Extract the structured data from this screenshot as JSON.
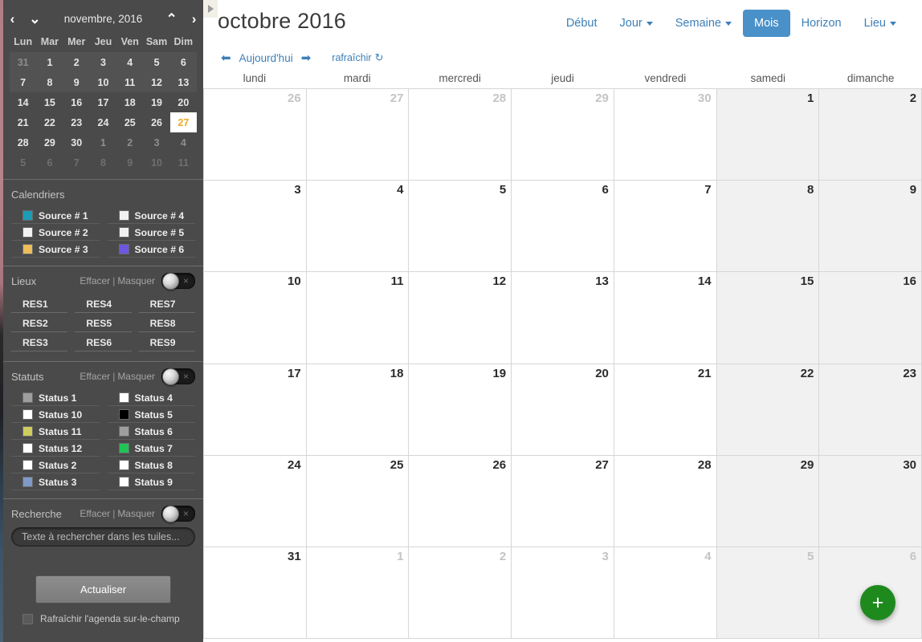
{
  "sidebar": {
    "mini_calendar": {
      "title": "novembre, 2016",
      "nav": {
        "prev": "‹",
        "down": "⌄",
        "up": "⌃",
        "next": "›"
      },
      "weekday_headers": [
        "Lun",
        "Mar",
        "Mer",
        "Jeu",
        "Ven",
        "Sam",
        "Dim"
      ],
      "weeks": [
        [
          {
            "d": "31",
            "t": "muted"
          },
          {
            "d": "1",
            "t": "cur"
          },
          {
            "d": "2",
            "t": "cur"
          },
          {
            "d": "3",
            "t": "cur"
          },
          {
            "d": "4",
            "t": "cur"
          },
          {
            "d": "5",
            "t": "cur"
          },
          {
            "d": "6",
            "t": "cur"
          }
        ],
        [
          {
            "d": "7",
            "t": "cur"
          },
          {
            "d": "8",
            "t": "cur"
          },
          {
            "d": "9",
            "t": "cur"
          },
          {
            "d": "10",
            "t": "cur"
          },
          {
            "d": "11",
            "t": "cur"
          },
          {
            "d": "12",
            "t": "cur"
          },
          {
            "d": "13",
            "t": "cur"
          }
        ],
        [
          {
            "d": "14",
            "t": "cur"
          },
          {
            "d": "15",
            "t": "cur"
          },
          {
            "d": "16",
            "t": "cur"
          },
          {
            "d": "17",
            "t": "cur"
          },
          {
            "d": "18",
            "t": "cur"
          },
          {
            "d": "19",
            "t": "cur"
          },
          {
            "d": "20",
            "t": "cur"
          }
        ],
        [
          {
            "d": "21",
            "t": "cur"
          },
          {
            "d": "22",
            "t": "cur"
          },
          {
            "d": "23",
            "t": "cur"
          },
          {
            "d": "24",
            "t": "cur"
          },
          {
            "d": "25",
            "t": "cur"
          },
          {
            "d": "26",
            "t": "cur"
          },
          {
            "d": "27",
            "t": "today"
          }
        ],
        [
          {
            "d": "28",
            "t": "cur"
          },
          {
            "d": "29",
            "t": "cur"
          },
          {
            "d": "30",
            "t": "cur"
          },
          {
            "d": "1",
            "t": "muted"
          },
          {
            "d": "2",
            "t": "muted"
          },
          {
            "d": "3",
            "t": "muted"
          },
          {
            "d": "4",
            "t": "muted"
          }
        ],
        [
          {
            "d": "5",
            "t": "dim"
          },
          {
            "d": "6",
            "t": "dim"
          },
          {
            "d": "7",
            "t": "dim"
          },
          {
            "d": "8",
            "t": "dim"
          },
          {
            "d": "9",
            "t": "dim"
          },
          {
            "d": "10",
            "t": "dim"
          },
          {
            "d": "11",
            "t": "dim"
          }
        ]
      ],
      "shaded_weeks": [
        0,
        1
      ]
    },
    "calendriers": {
      "title": "Calendriers",
      "col_left": [
        {
          "label": "Source # 1",
          "color": "#1b9cb7"
        },
        {
          "label": "Source # 2",
          "color": "#f2f2f2"
        },
        {
          "label": "Source # 3",
          "color": "#edbd5a"
        }
      ],
      "col_right": [
        {
          "label": "Source # 4",
          "color": "#f2f2f2"
        },
        {
          "label": "Source # 5",
          "color": "#f2f2f2"
        },
        {
          "label": "Source # 6",
          "color": "#6f56e0"
        }
      ]
    },
    "lieux": {
      "title": "Lieux",
      "clear_label": "Effacer",
      "separator": "|",
      "hide_label": "Masquer",
      "toggle_x": "×",
      "col1": [
        "RES1",
        "RES2",
        "RES3"
      ],
      "col2": [
        "RES4",
        "RES5",
        "RES6"
      ],
      "col3": [
        "RES7",
        "RES8",
        "RES9"
      ]
    },
    "statuts": {
      "title": "Statuts",
      "clear_label": "Effacer",
      "separator": "|",
      "hide_label": "Masquer",
      "toggle_x": "×",
      "col_left": [
        {
          "label": "Status 1",
          "color": "#9e9e9e"
        },
        {
          "label": "Status 10",
          "color": "#ffffff"
        },
        {
          "label": "Status 11",
          "color": "#cfcc5d"
        },
        {
          "label": "Status 12",
          "color": "#ffffff"
        },
        {
          "label": "Status 2",
          "color": "#ffffff"
        },
        {
          "label": "Status 3",
          "color": "#7e9ac8"
        }
      ],
      "col_right": [
        {
          "label": "Status 4",
          "color": "#ffffff"
        },
        {
          "label": "Status 5",
          "color": "#000000"
        },
        {
          "label": "Status 6",
          "color": "#9e9e9e"
        },
        {
          "label": "Status 7",
          "color": "#22c257"
        },
        {
          "label": "Status 8",
          "color": "#ffffff"
        },
        {
          "label": "Status 9",
          "color": "#ffffff"
        }
      ]
    },
    "recherche": {
      "title": "Recherche",
      "clear_label": "Effacer",
      "separator": "|",
      "hide_label": "Masquer",
      "toggle_x": "×",
      "input_value": "",
      "input_placeholder": "Texte à rechercher dans les tuiles..."
    },
    "footer": {
      "refresh_button": "Actualiser",
      "auto_refresh_label": "Rafraîchir l'agenda sur-le-champ"
    }
  },
  "main": {
    "collapse_handle_icon": "chevron-right-icon",
    "title": "octobre 2016",
    "view_buttons": [
      {
        "label": "Début",
        "active": false,
        "caret": false
      },
      {
        "label": "Jour",
        "active": false,
        "caret": true
      },
      {
        "label": "Semaine",
        "active": false,
        "caret": true
      },
      {
        "label": "Mois",
        "active": true,
        "caret": false
      },
      {
        "label": "Horizon",
        "active": false,
        "caret": false
      },
      {
        "label": "Lieu",
        "active": false,
        "caret": true
      }
    ],
    "subbar": {
      "prev_icon": "⬅",
      "today_label": "Aujourd'hui",
      "next_icon": "➡",
      "refresh_label": "rafraîchir",
      "refresh_icon": "↻"
    },
    "weekday_headers": [
      "lundi",
      "mardi",
      "mercredi",
      "jeudi",
      "vendredi",
      "samedi",
      "dimanche"
    ],
    "weeks": [
      [
        {
          "d": "26",
          "o": true
        },
        {
          "d": "27",
          "o": true
        },
        {
          "d": "28",
          "o": true
        },
        {
          "d": "29",
          "o": true
        },
        {
          "d": "30",
          "o": true
        },
        {
          "d": "1",
          "o": false
        },
        {
          "d": "2",
          "o": false
        }
      ],
      [
        {
          "d": "3",
          "o": false
        },
        {
          "d": "4",
          "o": false
        },
        {
          "d": "5",
          "o": false
        },
        {
          "d": "6",
          "o": false
        },
        {
          "d": "7",
          "o": false
        },
        {
          "d": "8",
          "o": false
        },
        {
          "d": "9",
          "o": false
        }
      ],
      [
        {
          "d": "10",
          "o": false
        },
        {
          "d": "11",
          "o": false
        },
        {
          "d": "12",
          "o": false
        },
        {
          "d": "13",
          "o": false
        },
        {
          "d": "14",
          "o": false
        },
        {
          "d": "15",
          "o": false
        },
        {
          "d": "16",
          "o": false
        }
      ],
      [
        {
          "d": "17",
          "o": false
        },
        {
          "d": "18",
          "o": false
        },
        {
          "d": "19",
          "o": false
        },
        {
          "d": "20",
          "o": false
        },
        {
          "d": "21",
          "o": false
        },
        {
          "d": "22",
          "o": false
        },
        {
          "d": "23",
          "o": false
        }
      ],
      [
        {
          "d": "24",
          "o": false
        },
        {
          "d": "25",
          "o": false
        },
        {
          "d": "26",
          "o": false
        },
        {
          "d": "27",
          "o": false
        },
        {
          "d": "28",
          "o": false
        },
        {
          "d": "29",
          "o": false
        },
        {
          "d": "30",
          "o": false
        }
      ],
      [
        {
          "d": "31",
          "o": false
        },
        {
          "d": "1",
          "o": true
        },
        {
          "d": "2",
          "o": true
        },
        {
          "d": "3",
          "o": true
        },
        {
          "d": "4",
          "o": true
        },
        {
          "d": "5",
          "o": true
        },
        {
          "d": "6",
          "o": true
        }
      ]
    ],
    "weekend_columns": [
      5,
      6
    ],
    "fab": {
      "icon": "plus-icon",
      "label": "+",
      "color": "#1e8a1e"
    }
  },
  "theme": {
    "sidebar_bg": "#4a4a4a",
    "accent_blue": "#4a90c9",
    "link_blue": "#3c7fb8",
    "today_highlight": "#f0a81e"
  }
}
